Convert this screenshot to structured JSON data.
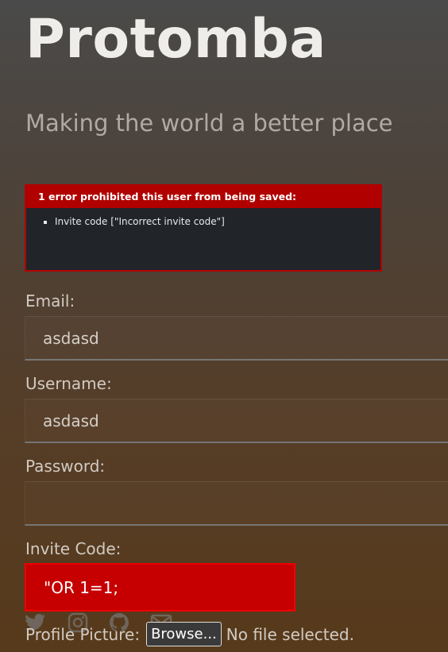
{
  "site": {
    "title": "Protomba",
    "tagline": "Making the world a better place"
  },
  "errors": {
    "heading": "1 error prohibited this user from being saved:",
    "items": [
      "Invite code [\"Incorrect invite code\"]"
    ]
  },
  "form": {
    "email": {
      "label": "Email:",
      "value": "asdasd"
    },
    "username": {
      "label": "Username:",
      "value": "asdasd"
    },
    "password": {
      "label": "Password:",
      "value": ""
    },
    "invite_code": {
      "label": "Invite Code:",
      "value": "\"OR 1=1;"
    },
    "profile_picture": {
      "label": "Profile Picture:",
      "button": "Browse...",
      "status": "No file selected."
    }
  },
  "social_icons": [
    "twitter-icon",
    "instagram-icon",
    "github-icon",
    "mail-icon"
  ],
  "colors": {
    "error_red": "#c60000",
    "error_panel": "#212429",
    "title": "#efede9"
  }
}
